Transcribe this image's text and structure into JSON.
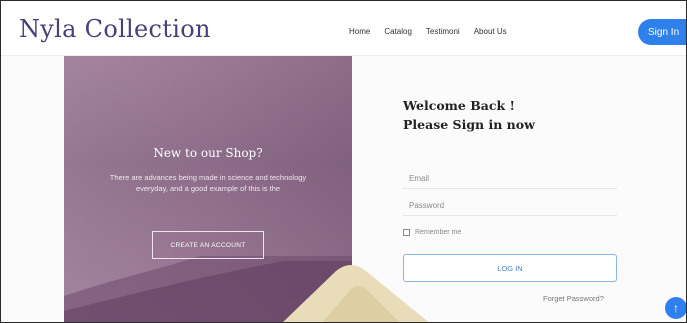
{
  "brand": {
    "name": "Nyla Collection"
  },
  "nav": {
    "links": [
      "Home",
      "Catalog",
      "Testimoni",
      "About Us"
    ],
    "signin_label": "Sign In"
  },
  "promo": {
    "title": "New to our Shop?",
    "text": "There are advances being made in science and technology everyday, and a good example of this is the",
    "cta_label": "CREATE AN ACCOUNT"
  },
  "form": {
    "welcome_line1": "Welcome Back !",
    "welcome_line2": "Please Sign in now",
    "email_placeholder": "Email",
    "password_placeholder": "Password",
    "remember_label": "Remember me",
    "login_label": "LOG IN",
    "forgot_label": "Forget Password?"
  },
  "scroll_top_icon": "arrow-up-icon",
  "colors": {
    "accent": "#2f80ed",
    "brand": "#4a3f7a",
    "promo_panel": "#8c6c88"
  }
}
